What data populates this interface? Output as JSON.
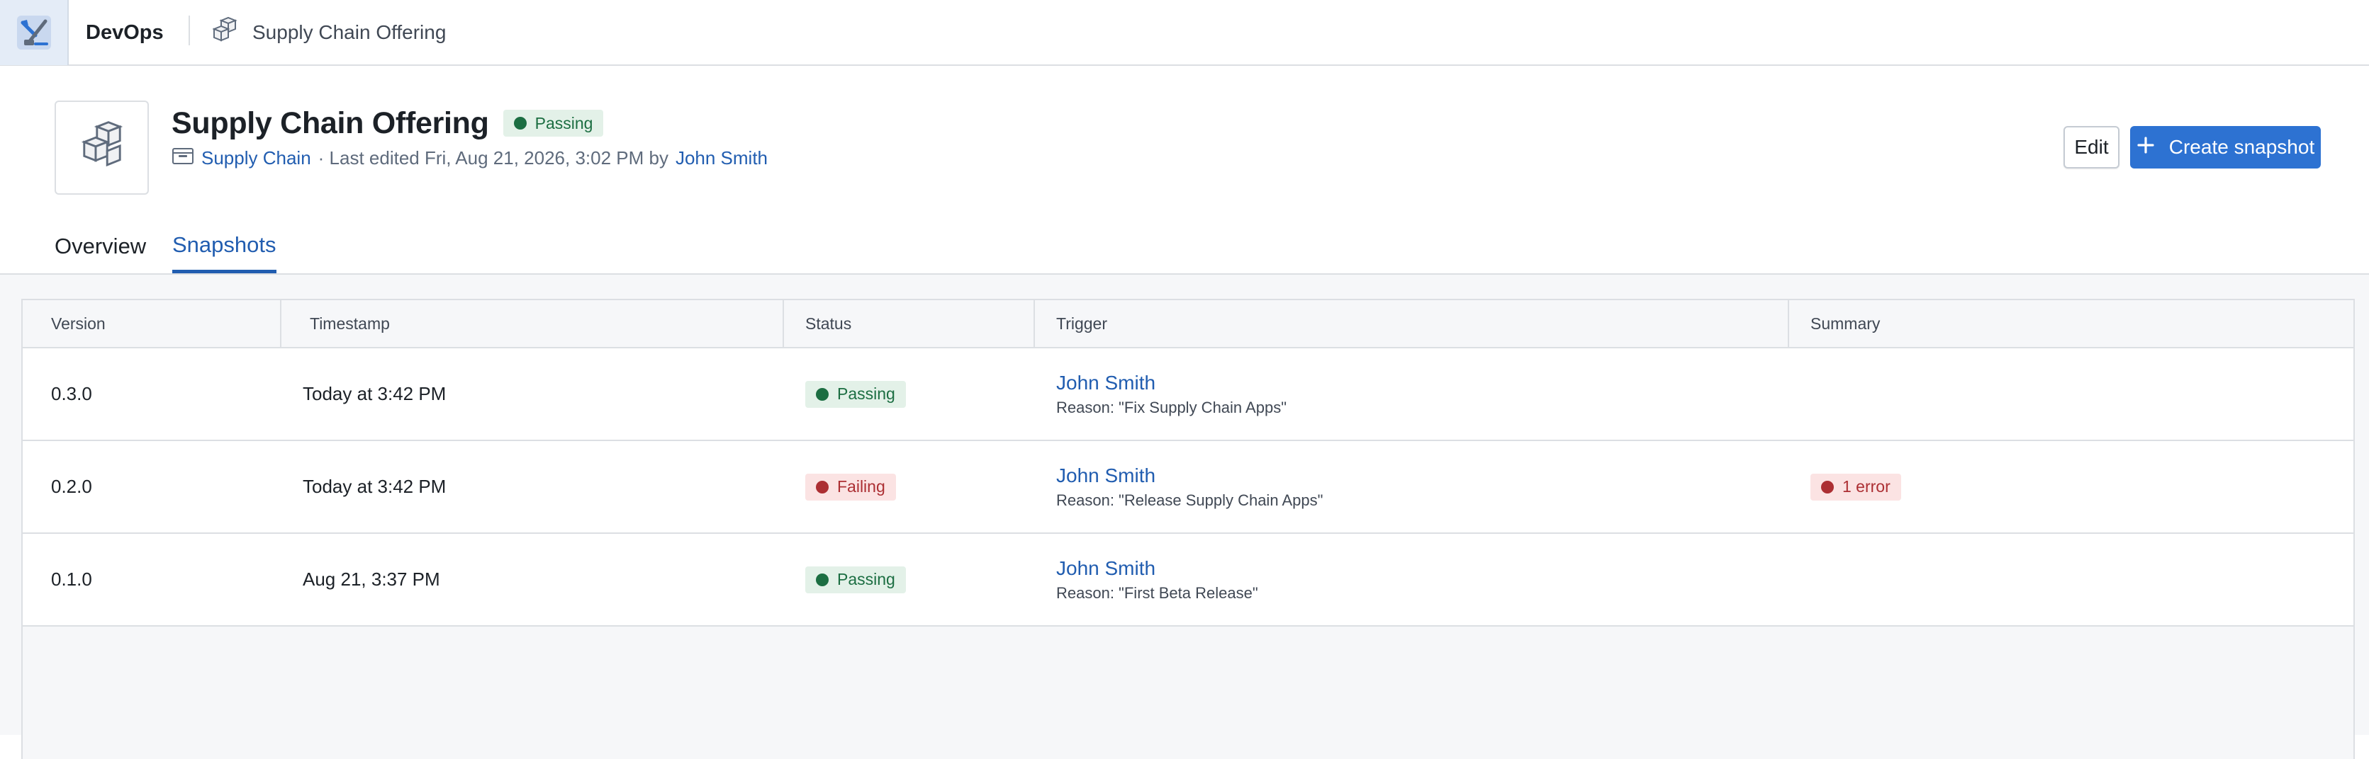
{
  "topbar": {
    "app_name": "DevOps",
    "breadcrumb": "Supply Chain Offering"
  },
  "header": {
    "title": "Supply Chain Offering",
    "status": "Passing",
    "project": "Supply Chain",
    "meta_text": "· Last edited Fri, Aug 21, 2026, 3:02 PM by",
    "editor": "John Smith"
  },
  "actions": {
    "edit_label": "Edit",
    "create_label": "Create snapshot"
  },
  "tabs": [
    {
      "label": "Overview",
      "active": false
    },
    {
      "label": "Snapshots",
      "active": true
    }
  ],
  "table": {
    "columns": [
      "Version",
      "Timestamp",
      "Status",
      "Trigger",
      "Summary"
    ],
    "rows": [
      {
        "version": "0.3.0",
        "timestamp": "Today at 3:42 PM",
        "status": "Passing",
        "trigger_user": "John Smith",
        "reason": "Reason: \"Fix Supply Chain Apps\"",
        "summary": ""
      },
      {
        "version": "0.2.0",
        "timestamp": "Today at 3:42 PM",
        "status": "Failing",
        "trigger_user": "John Smith",
        "reason": "Reason: \"Release Supply Chain Apps\"",
        "summary": "1 error"
      },
      {
        "version": "0.1.0",
        "timestamp": "Aug 21, 3:37 PM",
        "status": "Passing",
        "trigger_user": "John Smith",
        "reason": "Reason: \"First Beta Release\"",
        "summary": ""
      }
    ]
  },
  "colors": {
    "accent": "#2d72d2",
    "link": "#215db0",
    "passing": "#1c6e42",
    "failing": "#ac2f33"
  },
  "icons": {
    "app": "devops-tools-icon",
    "offering": "cubes-icon",
    "project": "folder-icon",
    "create": "plus-icon"
  }
}
